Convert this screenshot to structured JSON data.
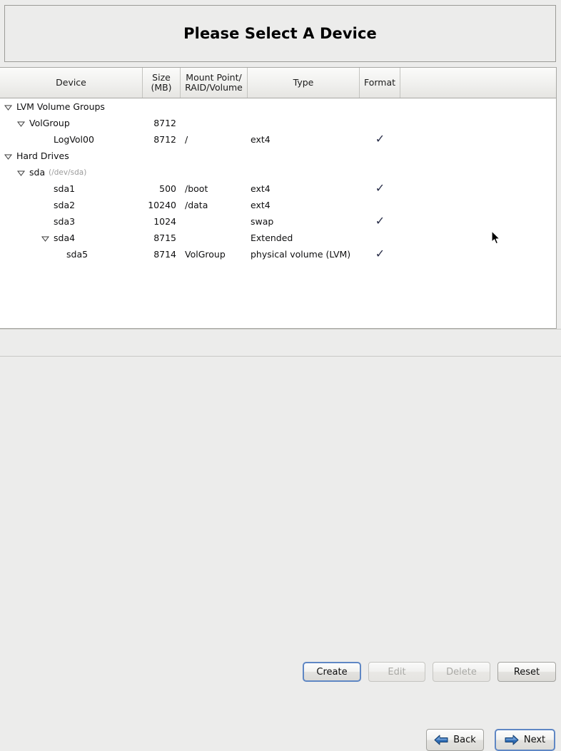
{
  "window": {
    "title": "Please Select A Device"
  },
  "table": {
    "columns": [
      {
        "label": "Device",
        "name": "column-header-device"
      },
      {
        "label": "Size\n(MB)",
        "name": "column-header-size"
      },
      {
        "label": "Mount Point/\nRAID/Volume",
        "name": "column-header-mount-point"
      },
      {
        "label": "Type",
        "name": "column-header-type"
      },
      {
        "label": "Format",
        "name": "column-header-format"
      },
      {
        "label": "",
        "name": "column-header-filler"
      }
    ],
    "rows": [
      {
        "device": "LVM Volume Groups",
        "path": "",
        "size": "",
        "mount": "",
        "type": "",
        "format": false,
        "indent": 0,
        "expander": "expanded"
      },
      {
        "device": "VolGroup",
        "path": "",
        "size": "8712",
        "mount": "",
        "type": "",
        "format": false,
        "indent": 1,
        "expander": "expanded"
      },
      {
        "device": "LogVol00",
        "path": "",
        "size": "8712",
        "mount": "/",
        "type": "ext4",
        "format": true,
        "indent": 2,
        "expander": "none"
      },
      {
        "device": "Hard Drives",
        "path": "",
        "size": "",
        "mount": "",
        "type": "",
        "format": false,
        "indent": 0,
        "expander": "expanded"
      },
      {
        "device": "sda",
        "path": "(/dev/sda)",
        "size": "",
        "mount": "",
        "type": "",
        "format": false,
        "indent": 1,
        "expander": "expanded"
      },
      {
        "device": "sda1",
        "path": "",
        "size": "500",
        "mount": "/boot",
        "type": "ext4",
        "format": true,
        "indent": 2,
        "expander": "none"
      },
      {
        "device": "sda2",
        "path": "",
        "size": "10240",
        "mount": "/data",
        "type": "ext4",
        "format": false,
        "indent": 2,
        "expander": "none"
      },
      {
        "device": "sda3",
        "path": "",
        "size": "1024",
        "mount": "",
        "type": "swap",
        "format": true,
        "indent": 2,
        "expander": "none"
      },
      {
        "device": "sda4",
        "path": "",
        "size": "8715",
        "mount": "",
        "type": "Extended",
        "format": false,
        "indent": 2,
        "expander": "expanded"
      },
      {
        "device": "sda5",
        "path": "",
        "size": "8714",
        "mount": "VolGroup",
        "type": "physical volume (LVM)",
        "format": true,
        "indent": 3,
        "expander": "none"
      }
    ],
    "check_glyph": "✓"
  },
  "actions": {
    "create": {
      "label": "Create",
      "enabled": true,
      "focused": true
    },
    "edit": {
      "label": "Edit",
      "enabled": false,
      "focused": false
    },
    "delete": {
      "label": "Delete",
      "enabled": false,
      "focused": false
    },
    "reset": {
      "label": "Reset",
      "enabled": true,
      "focused": false
    }
  },
  "navigation": {
    "back": {
      "label": "Back",
      "icon": "arrow-left-icon",
      "focused": false
    },
    "next": {
      "label": "Next",
      "icon": "arrow-right-icon",
      "focused": true
    }
  },
  "colors": {
    "window_bg": "#ececeb",
    "table_bg": "#ffffff",
    "border": "#a8a8a4",
    "focus_blue": "#5f87c4",
    "arrow_blue": "#2e6cb5",
    "check_navy": "#262b46",
    "muted_text": "#9b9b9b"
  }
}
